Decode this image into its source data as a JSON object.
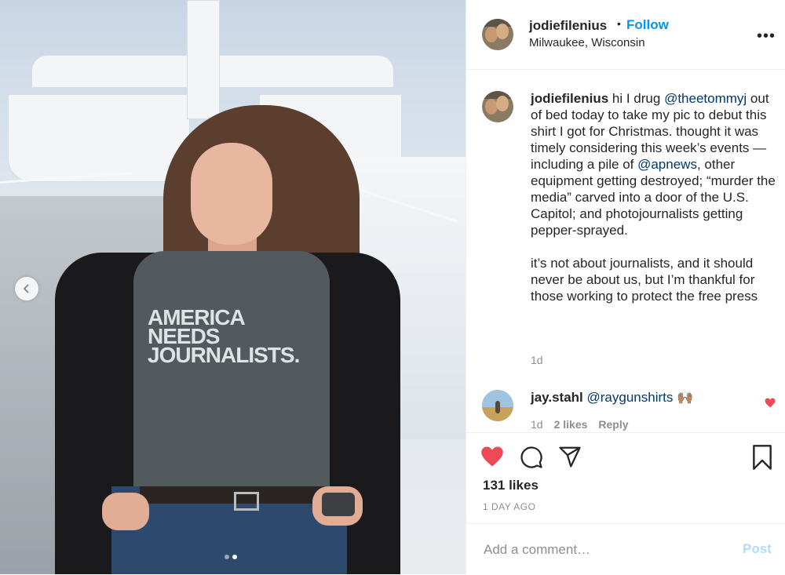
{
  "photo": {
    "shirt_lines": [
      "AMERICA",
      "NEEDS",
      "JOURNALISTS."
    ],
    "carousel_prev_icon": "chevron-left-icon",
    "carousel_dots": 2,
    "carousel_active": 1
  },
  "header": {
    "username": "jodiefilenius",
    "separator": "•",
    "follow_label": "Follow",
    "location": "Milwaukee, Wisconsin",
    "more_icon": "more-options-icon",
    "more_label": "•••"
  },
  "caption": {
    "username": "jodiefilenius",
    "text_1": " hi I drug ",
    "mention_1": "@theetommyj",
    "text_2": " out of bed today to take my pic to debut this shirt I got for Christmas. thought it was timely considering this week’s events — including a pile of ",
    "mention_2": "@apnews",
    "text_3": ", other equipment getting destroyed; “murder the media” carved into a door of the U.S. Capitol; and photojournalists getting pepper-sprayed.",
    "paragraph_2": "it’s not about journalists, and it should never be about us, but I’m thankful for those working to protect the free press",
    "time": "1d"
  },
  "comment": {
    "username": "jay.stahl",
    "mention": "@raygunshirts",
    "emoji": "🙌🏽",
    "time": "1d",
    "likes": "2 likes",
    "reply_label": "Reply",
    "like_color": "#ed4956"
  },
  "actions": {
    "like_icon": "heart-filled-icon",
    "like_color": "#ed4956",
    "comment_icon": "comment-icon",
    "share_icon": "share-icon",
    "save_icon": "bookmark-icon",
    "likes_count": "131 likes",
    "post_time": "1 DAY AGO"
  },
  "add_comment": {
    "placeholder": "Add a comment…",
    "post_label": "Post"
  },
  "colors": {
    "accent": "#0095f6",
    "mention": "#00376b",
    "muted": "#8e8e8e",
    "post_disabled": "#b3dbff"
  }
}
